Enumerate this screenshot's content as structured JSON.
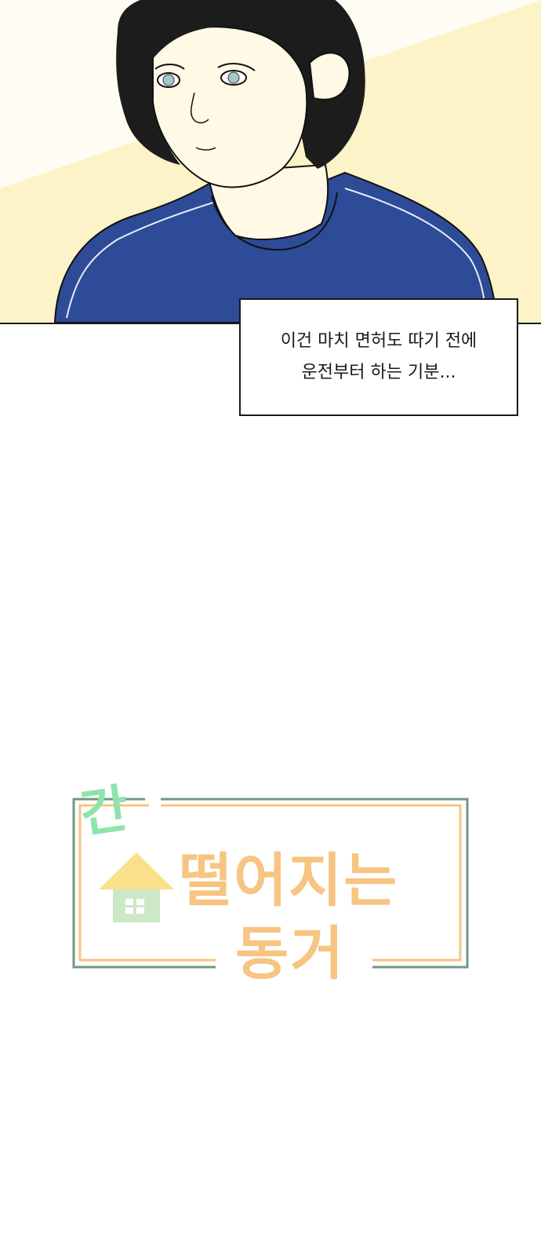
{
  "caption": {
    "line1": "이건 마치 면허도 따기 전에",
    "line2": "운전부터 하는 기분..."
  },
  "logo": {
    "gan": "간",
    "line1": "떨어지는",
    "line2": "동거"
  },
  "colors": {
    "panel_bg": "#fdf7d8",
    "shirt": "#2e4b97",
    "hair": "#1c1c1c",
    "skin": "#fff9e6",
    "logo_green": "#8fe3ad",
    "logo_orange": "#f7c482",
    "house_yellow": "#f9e08a",
    "house_green": "#cce8c4",
    "frame_green": "#6f9a7f"
  }
}
